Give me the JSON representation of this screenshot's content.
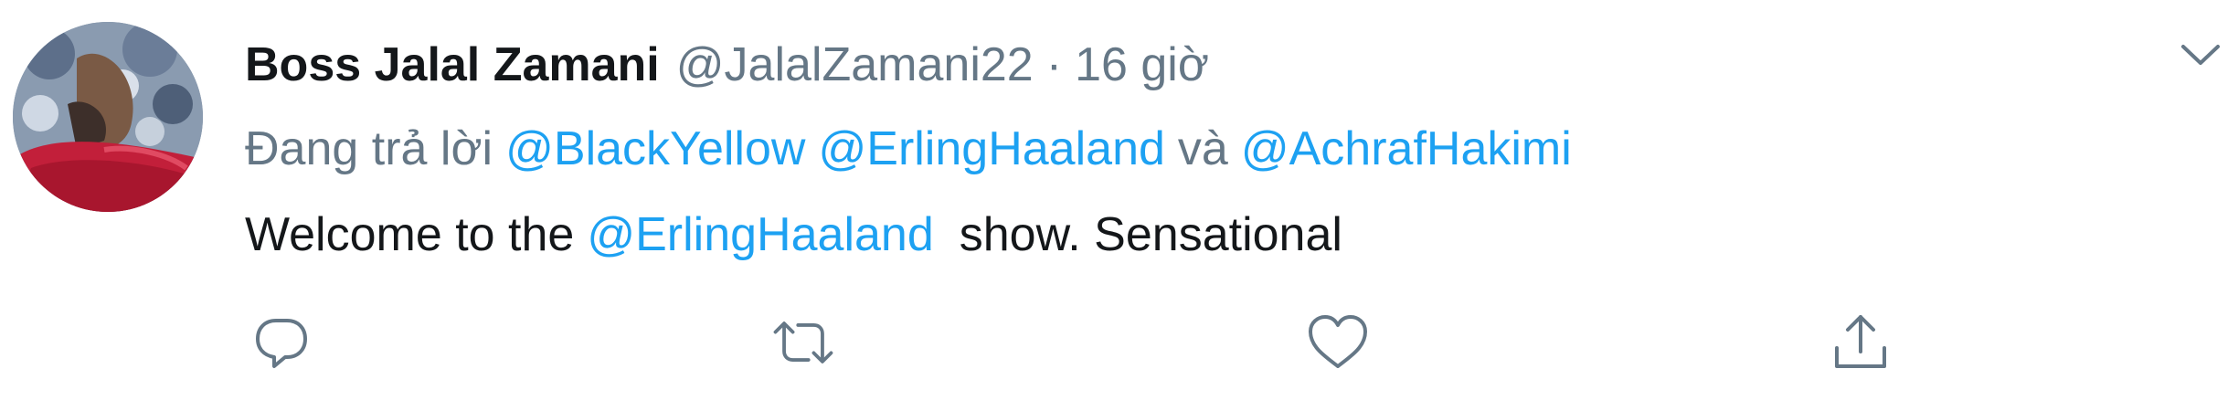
{
  "tweet": {
    "display_name": "Boss Jalal Zamani",
    "handle": "@JalalZamani22",
    "separator": "·",
    "time": "16 giờ",
    "reply_prefix": "Đang trả lời",
    "reply_mentions": [
      "@BlackYellow",
      "@ErlingHaaland"
    ],
    "reply_joiner": "và",
    "reply_last_mention": "@AchrafHakimi",
    "body_before": "Welcome to the",
    "body_mention": "@ErlingHaaland",
    "body_after": "show. Sensational"
  },
  "icons": {
    "avatar": "profile-avatar",
    "more": "chevron-down-icon",
    "reply": "reply-bubble-icon",
    "retweet": "retweet-icon",
    "like": "heart-icon",
    "share": "share-upload-icon"
  },
  "colors": {
    "text_primary": "#14171a",
    "text_secondary": "#657786",
    "link": "#1da1f2",
    "icon": "#657786",
    "background": "#ffffff"
  }
}
